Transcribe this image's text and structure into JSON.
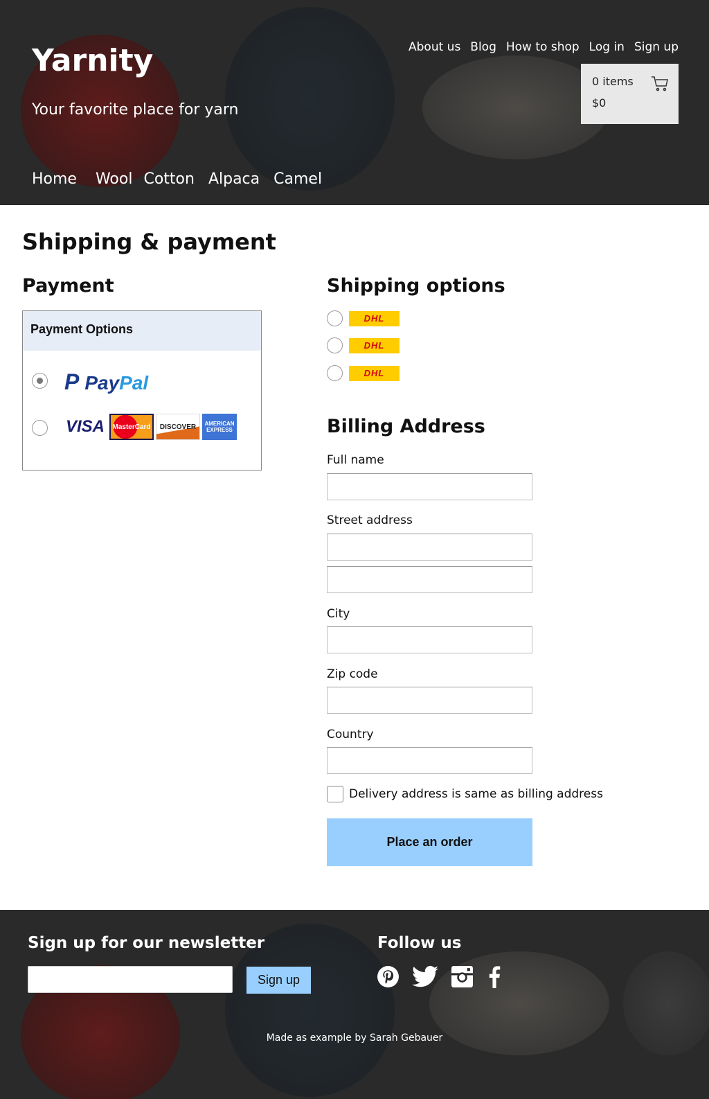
{
  "header": {
    "logo": "Yarnity",
    "tagline": "Your favorite place for yarn",
    "top_nav": [
      "About us",
      "Blog",
      "How to shop",
      "Log in",
      "Sign up"
    ],
    "cart": {
      "items": "0 items",
      "total": "$0"
    },
    "main_nav": [
      "Home",
      "Wool",
      "Cotton",
      "Alpaca",
      "Camel"
    ]
  },
  "page_title": "Shipping & payment",
  "payment": {
    "heading": "Payment",
    "box_title": "Payment Options",
    "options": [
      {
        "name": "PayPal",
        "selected": true
      },
      {
        "name": "Cards",
        "selected": false,
        "cards": [
          "VISA",
          "MasterCard",
          "DISCOVER",
          "AMERICAN EXPRESS"
        ]
      }
    ],
    "paypal_a": "Pay",
    "paypal_b": "Pal"
  },
  "shipping": {
    "heading": "Shipping options",
    "options": [
      "DHL",
      "DHL",
      "DHL"
    ]
  },
  "billing": {
    "heading": "Billing Address",
    "labels": {
      "full_name": "Full name",
      "street": "Street address",
      "city": "City",
      "zip": "Zip code",
      "country": "Country"
    },
    "same_address": "Delivery address is same as billing address",
    "submit": "Place an order"
  },
  "footer": {
    "newsletter_heading": "Sign up for our newsletter",
    "signup_button": "Sign up",
    "follow_heading": "Follow us",
    "social": [
      "pinterest-icon",
      "twitter-icon",
      "instagram-icon",
      "facebook-icon"
    ],
    "credit": "Made as example by Sarah Gebauer"
  },
  "colors": {
    "header_bg": "#2a2a2a",
    "button": "#99cfff",
    "dhl": "#ffcc00"
  }
}
